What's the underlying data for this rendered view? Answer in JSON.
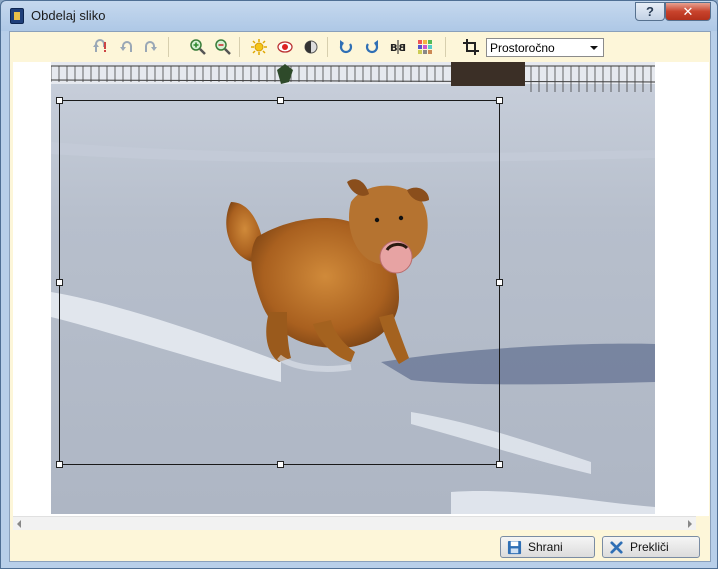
{
  "window": {
    "title": "Obdelaj sliko",
    "help_label": "?",
    "close_label": "✕"
  },
  "toolbar": {
    "tools": [
      {
        "name": "undo-all-icon"
      },
      {
        "name": "undo-icon"
      },
      {
        "name": "redo-icon"
      },
      {
        "name": "zoom-in-icon"
      },
      {
        "name": "zoom-out-icon"
      },
      {
        "name": "brightness-icon"
      },
      {
        "name": "red-eye-icon"
      },
      {
        "name": "contrast-icon"
      },
      {
        "name": "rotate-left-icon"
      },
      {
        "name": "rotate-right-icon"
      },
      {
        "name": "flip-icon"
      },
      {
        "name": "color-grid-icon"
      },
      {
        "name": "crop-icon"
      }
    ],
    "crop_ratio": "Prostoročno"
  },
  "image": {
    "subject": "dog-in-snow"
  },
  "buttons": {
    "save": "Shrani",
    "cancel": "Prekliči"
  },
  "colors": {
    "accent": "#2f6fb5",
    "client_bg": "#fdf6d9"
  }
}
